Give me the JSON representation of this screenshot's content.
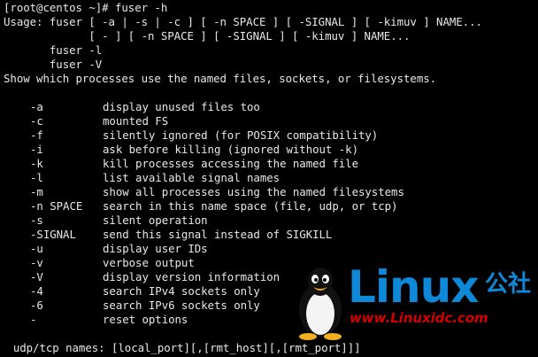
{
  "terminal": {
    "lines": [
      "[root@centos ~]# fuser -h",
      "Usage: fuser [ -a | -s | -c ] [ -n SPACE ] [ -SIGNAL ] [ -kimuv ] NAME...",
      "             [ - ] [ -n SPACE ] [ -SIGNAL ] [ -kimuv ] NAME...",
      "       fuser -l",
      "       fuser -V",
      "Show which processes use the named files, sockets, or filesystems."
    ],
    "options": [
      {
        "flag": "-a",
        "desc": "display unused files too"
      },
      {
        "flag": "-c",
        "desc": "mounted FS"
      },
      {
        "flag": "-f",
        "desc": "silently ignored (for POSIX compatibility)"
      },
      {
        "flag": "-i",
        "desc": "ask before killing (ignored without -k)"
      },
      {
        "flag": "-k",
        "desc": "kill processes accessing the named file"
      },
      {
        "flag": "-l",
        "desc": "list available signal names"
      },
      {
        "flag": "-m",
        "desc": "show all processes using the named filesystems"
      },
      {
        "flag": "-n SPACE",
        "desc": "search in this name space (file, udp, or tcp)"
      },
      {
        "flag": "-s",
        "desc": "silent operation"
      },
      {
        "flag": "-SIGNAL",
        "desc": "send this signal instead of SIGKILL"
      },
      {
        "flag": "-u",
        "desc": "display user IDs"
      },
      {
        "flag": "-v",
        "desc": "verbose output"
      },
      {
        "flag": "-V",
        "desc": "display version information"
      },
      {
        "flag": "-4",
        "desc": "search IPv4 sockets only"
      },
      {
        "flag": "-6",
        "desc": "search IPv6 sockets only"
      },
      {
        "flag": "-",
        "desc": "reset options"
      }
    ],
    "footer": "  udp/tcp names: [local_port][,[rmt_host][,[rmt_port]]]"
  },
  "watermark": {
    "brand": "Linux",
    "brand_cn": "公社",
    "url": "www.Linuxidc.com",
    "brand_color": "#0e88d8",
    "url_color": "#d40000"
  },
  "colors": {
    "background": "#000000",
    "text": "#e8e8e8"
  }
}
